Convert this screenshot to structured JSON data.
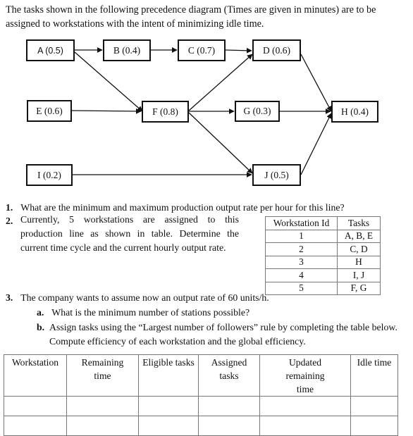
{
  "intro": "The tasks shown in the following precedence diagram (Times are given in minutes) are to be assigned to workstations with the intent of minimizing idle time.",
  "diagram": {
    "nodes": {
      "A": "A (0.5)",
      "B": "B (0.4)",
      "C": "C (0.7)",
      "D": "D (0.6)",
      "E": "E (0.6)",
      "F": "F (0.8)",
      "G": "G (0.3)",
      "H": "H (0.4)",
      "I": "I (0.2)",
      "J": "J (0.5)"
    },
    "edges": [
      [
        "A",
        "B"
      ],
      [
        "B",
        "C"
      ],
      [
        "C",
        "D"
      ],
      [
        "A",
        "F"
      ],
      [
        "E",
        "F"
      ],
      [
        "F",
        "D"
      ],
      [
        "F",
        "G"
      ],
      [
        "F",
        "J"
      ],
      [
        "D",
        "H"
      ],
      [
        "G",
        "H"
      ],
      [
        "I",
        "J"
      ],
      [
        "J",
        "H"
      ]
    ]
  },
  "questions": {
    "q1": {
      "num": "1.",
      "text": "What are the minimum and maximum production output rate per hour for this line?"
    },
    "q2": {
      "num": "2.",
      "text": "Currently, 5 workstations are assigned to this production line as shown in table. Determine the current time cycle and the current hourly output rate."
    },
    "q3": {
      "num": "3.",
      "text": "The company wants to assume now an output rate of 60 units/h."
    },
    "q3a": {
      "num": "a.",
      "text": "What is the minimum number of stations possible?"
    },
    "q3b": {
      "num": "b.",
      "text": "Assign tasks using the “Largest number of followers” rule by completing the table below. Compute efficiency of each workstation and the global efficiency."
    }
  },
  "workstation_table": {
    "headers": [
      "Workstation Id",
      "Tasks"
    ],
    "rows": [
      [
        "1",
        "A, B, E"
      ],
      [
        "2",
        "C, D"
      ],
      [
        "3",
        "H"
      ],
      [
        "4",
        "I, J"
      ],
      [
        "5",
        "F, G"
      ]
    ]
  },
  "assignment_table": {
    "headers": [
      "Workstation",
      "Remaining time",
      "Eligible tasks",
      "Assigned tasks",
      "Updated remaining time",
      "Idle time"
    ],
    "rows": [
      [
        "",
        "",
        "",
        "",
        "",
        ""
      ],
      [
        "",
        "",
        "",
        "",
        "",
        ""
      ]
    ]
  }
}
